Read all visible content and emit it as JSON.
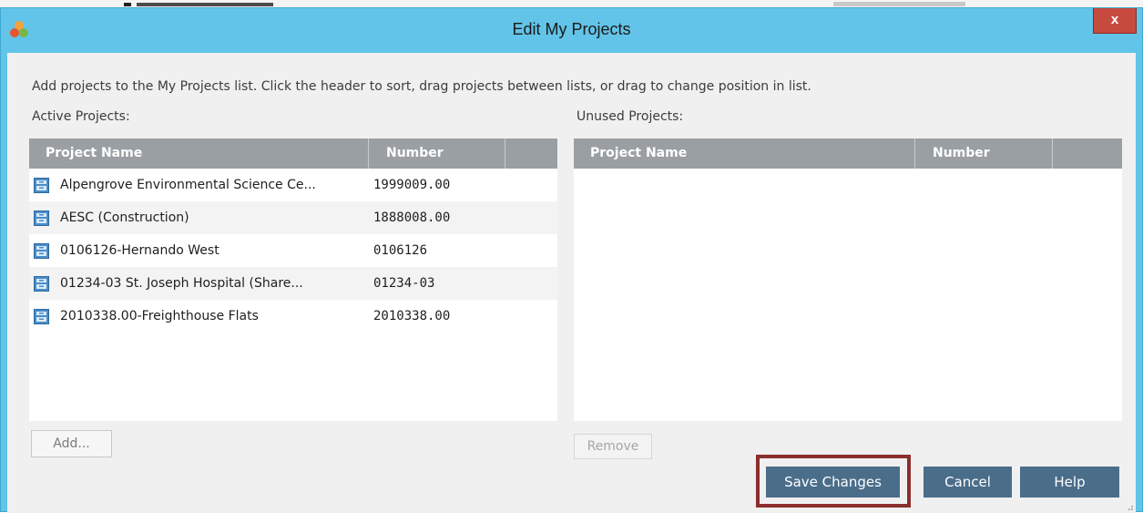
{
  "window": {
    "title": "Edit My Projects",
    "close_label": "x"
  },
  "instructions": "Add projects to the My Projects list. Click the header to sort, drag projects between lists, or drag to change position in list.",
  "active": {
    "label": "Active Projects:",
    "columns": {
      "name": "Project Name",
      "number": "Number"
    },
    "rows": [
      {
        "name": "Alpengrove Environmental Science Ce...",
        "number": "1999009.00",
        "icon": "project-icon"
      },
      {
        "name": "AESC (Construction)",
        "number": "1888008.00",
        "icon": "project-icon"
      },
      {
        "name": "0106126-Hernando West",
        "number": "0106126",
        "icon": "project-icon"
      },
      {
        "name": "01234-03 St. Joseph Hospital (Share...",
        "number": "01234-03",
        "icon": "project-icon"
      },
      {
        "name": "2010338.00-Freighthouse Flats",
        "number": "2010338.00",
        "icon": "project-icon"
      }
    ],
    "add_label": "Add..."
  },
  "unused": {
    "label": "Unused Projects:",
    "columns": {
      "name": "Project Name",
      "number": "Number"
    },
    "remove_label": "Remove"
  },
  "footer": {
    "save_label": "Save Changes",
    "cancel_label": "Cancel",
    "help_label": "Help"
  },
  "colors": {
    "titlebar": "#62c4e8",
    "header": "#9a9fa3",
    "button": "#4a6d8a",
    "close": "#c74a3e",
    "highlight": "#8b2e2e"
  }
}
